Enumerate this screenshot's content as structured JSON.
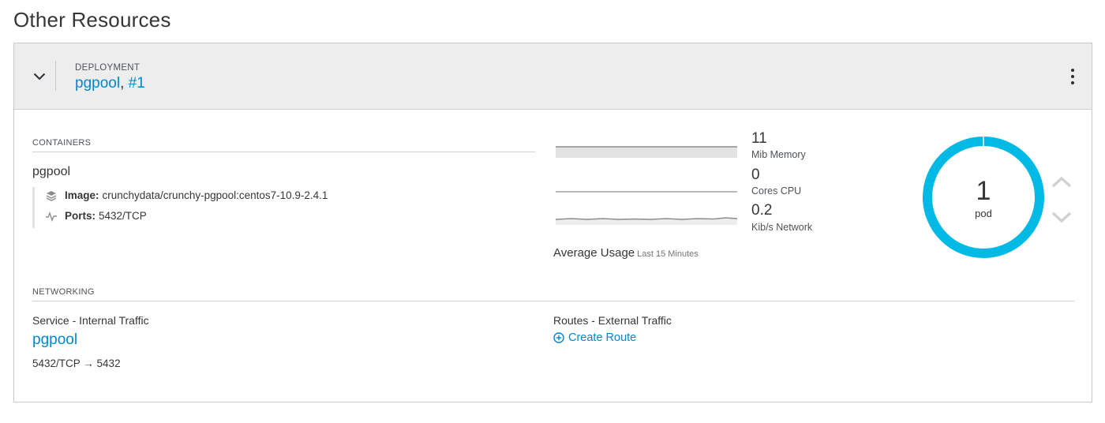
{
  "page": {
    "title": "Other Resources"
  },
  "deployment": {
    "kind_label": "DEPLOYMENT",
    "name": "pgpool",
    "separator": ",",
    "revision": "#1"
  },
  "containers": {
    "section_label": "CONTAINERS",
    "items": [
      {
        "name": "pgpool",
        "image_label": "Image:",
        "image_value": "crunchydata/crunchy-pgpool:centos7-10.9-2.4.1",
        "ports_label": "Ports:",
        "ports_value": "5432/TCP"
      }
    ]
  },
  "metrics": {
    "memory": {
      "value": "11",
      "label": "Mib Memory"
    },
    "cpu": {
      "value": "0",
      "label": "Cores CPU"
    },
    "network": {
      "value": "0.2",
      "label": "Kib/s Network"
    },
    "average_usage_label": "Average Usage",
    "period_label": "Last 15 Minutes"
  },
  "pods": {
    "count": "1",
    "label": "pod",
    "ring_color": "#00b9e4"
  },
  "networking": {
    "section_label": "NETWORKING",
    "service_title": "Service - Internal Traffic",
    "service_name": "pgpool",
    "port_mapping": "5432/TCP → 5432",
    "routes_title": "Routes - External Traffic",
    "create_route_label": "Create Route"
  },
  "icons": {
    "collapse": "chevron-down-icon",
    "kebab": "kebab-menu-icon",
    "image": "layers-icon",
    "ports": "pulse-icon",
    "scale_up": "chevron-up-icon",
    "scale_down": "chevron-down-icon",
    "create_route": "plus-circle-icon"
  },
  "colors": {
    "link": "#0088ce",
    "accent": "#00b9e4",
    "header_bg": "#ededed"
  }
}
